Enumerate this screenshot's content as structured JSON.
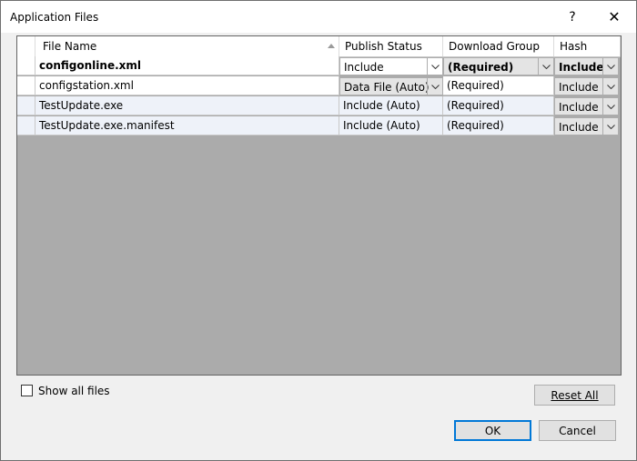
{
  "dialog": {
    "title": "Application Files",
    "help_label": "?",
    "close_label": "✕"
  },
  "columns": {
    "file_name": "File Name",
    "publish_status": "Publish Status",
    "download_group": "Download Group",
    "hash": "Hash"
  },
  "rows": [
    {
      "file": "configonline.xml",
      "status": "Include",
      "group": "(Required)",
      "hash": "Include"
    },
    {
      "file": "configstation.xml",
      "status": "Data File (Auto)",
      "group": "(Required)",
      "hash": "Include"
    },
    {
      "file": "TestUpdate.exe",
      "status": "Include (Auto)",
      "group": "(Required)",
      "hash": "Include"
    },
    {
      "file": "TestUpdate.exe.manifest",
      "status": "Include (Auto)",
      "group": "(Required)",
      "hash": "Include"
    }
  ],
  "options": {
    "show_all_files_label": "Show all files",
    "show_all_files_checked": false
  },
  "buttons": {
    "reset_all": "Reset All",
    "ok": "OK",
    "cancel": "Cancel"
  },
  "colors": {
    "accent": "#0078d7",
    "grid_empty": "#ababab",
    "alt_row": "#eef2f9"
  }
}
